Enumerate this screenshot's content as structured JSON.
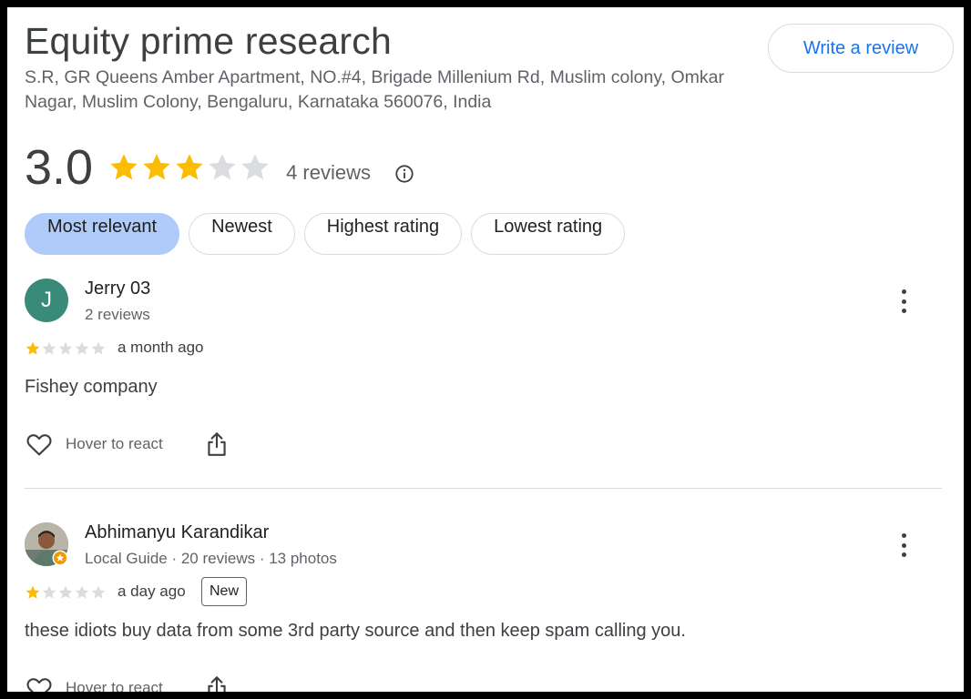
{
  "place": {
    "title": "Equity prime research",
    "address": "S.R, GR Queens Amber Apartment, NO.#4, Brigade Millenium Rd, Muslim colony, Omkar Nagar, Muslim Colony, Bengaluru, Karnataka 560076, India"
  },
  "write_review_label": "Write a review",
  "rating": {
    "value": "3.0",
    "stars": 3,
    "max_stars": 5,
    "count_label": "4 reviews",
    "star_color": "#fbbc04",
    "empty_star_color": "#dadce0"
  },
  "sort_chips": [
    {
      "label": "Most relevant",
      "active": true
    },
    {
      "label": "Newest",
      "active": false
    },
    {
      "label": "Highest rating",
      "active": false
    },
    {
      "label": "Lowest rating",
      "active": false
    }
  ],
  "reviews": [
    {
      "avatar_initial": "J",
      "avatar_color": "#3a8a7a",
      "name": "Jerry 03",
      "meta": "2 reviews",
      "stars": 1,
      "time": "a month ago",
      "badge": "",
      "text": "Fishey company",
      "react_label": "Hover to react"
    },
    {
      "avatar_initial": "",
      "avatar_color": "#8a8f8c",
      "name": "Abhimanyu Karandikar",
      "meta": "Local Guide · 20 reviews · 13 photos",
      "stars": 1,
      "time": "a day ago",
      "badge": "New",
      "text": "these idiots buy data from some 3rd party source and then keep spam calling you.",
      "react_label": "Hover to react"
    }
  ],
  "icons": {
    "info": "info-icon",
    "more": "more-vert-icon",
    "heart": "heart-icon",
    "share": "share-icon",
    "star": "star-icon",
    "local_guide": "local-guide-badge-icon"
  }
}
